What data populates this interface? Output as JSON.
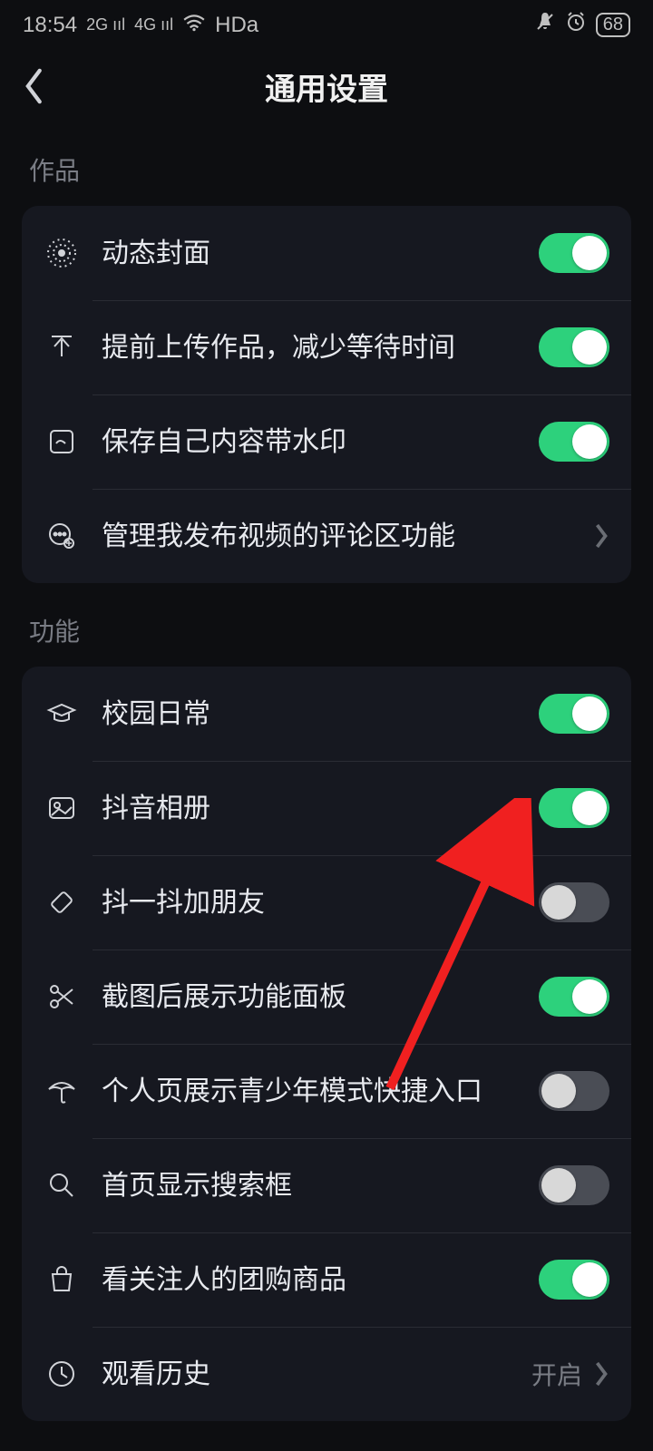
{
  "statusbar": {
    "time": "18:54",
    "net2g": "2G",
    "net4g": "4G",
    "hd": "HDa",
    "battery": "68"
  },
  "header": {
    "title": "通用设置"
  },
  "sections": {
    "works": {
      "title": "作品",
      "items": {
        "dynamic_cover": "动态封面",
        "preupload": "提前上传作品，减少等待时间",
        "watermark": "保存自己内容带水印",
        "comment_mgmt": "管理我发布视频的评论区功能"
      }
    },
    "features": {
      "title": "功能",
      "items": {
        "campus": "校园日常",
        "album": "抖音相册",
        "shake": "抖一抖加朋友",
        "screenshot": "截图后展示功能面板",
        "teenmode": "个人页展示青少年模式快捷入口",
        "searchbox": "首页显示搜索框",
        "groupbuy": "看关注人的团购商品",
        "history": "观看历史",
        "history_status": "开启"
      }
    }
  },
  "toggles": {
    "dynamic_cover": true,
    "preupload": true,
    "watermark": true,
    "campus": true,
    "album": true,
    "shake": false,
    "screenshot": true,
    "teenmode": false,
    "searchbox": false,
    "groupbuy": true
  }
}
